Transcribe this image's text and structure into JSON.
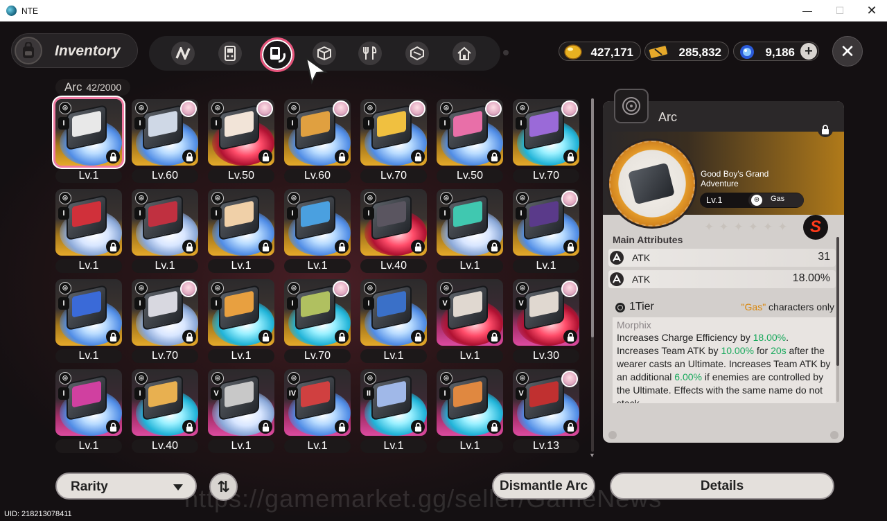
{
  "window": {
    "title": "NTE",
    "min": "—",
    "max": "☐",
    "close": "✕"
  },
  "header": {
    "title": "Inventory",
    "close_glyph": "✕"
  },
  "categories": [
    {
      "icon": "n-logo-icon"
    },
    {
      "icon": "handheld-console-icon"
    },
    {
      "icon": "arc-disc-icon",
      "active": true
    },
    {
      "icon": "cube-icon"
    },
    {
      "icon": "fork-knife-icon"
    },
    {
      "icon": "package-icon"
    },
    {
      "icon": "house-icon"
    }
  ],
  "currencies": [
    {
      "icon": "gold-egg-icon",
      "value": "427,171"
    },
    {
      "icon": "ticket-icon",
      "value": "285,832"
    },
    {
      "icon": "blue-orb-icon",
      "value": "9,186"
    }
  ],
  "currency_plus": "+",
  "arc": {
    "label": "Arc",
    "count": "42/2000"
  },
  "cards": [
    {
      "level": "Lv.1",
      "tier": "I",
      "rarity": "gold",
      "swirl": "blue",
      "avatar": false,
      "selected": true,
      "art": "#e8e8e8"
    },
    {
      "level": "Lv.60",
      "tier": "I",
      "rarity": "gold",
      "swirl": "blue",
      "avatar": true,
      "art": "#cfd8e6"
    },
    {
      "level": "Lv.50",
      "tier": "I",
      "rarity": "gold",
      "swirl": "red",
      "avatar": true,
      "art": "#f2e4d8"
    },
    {
      "level": "Lv.60",
      "tier": "I",
      "rarity": "gold",
      "swirl": "blue",
      "avatar": true,
      "art": "#e0a040"
    },
    {
      "level": "Lv.70",
      "tier": "I",
      "rarity": "gold",
      "swirl": "blue",
      "avatar": true,
      "art": "#f0c040"
    },
    {
      "level": "Lv.50",
      "tier": "I",
      "rarity": "gold",
      "swirl": "blue",
      "avatar": true,
      "art": "#e86fa8"
    },
    {
      "level": "Lv.70",
      "tier": "I",
      "rarity": "gold",
      "swirl": "cyan",
      "avatar": true,
      "art": "#9a6ad8"
    },
    {
      "level": "Lv.1",
      "tier": "I",
      "rarity": "gold",
      "swirl": "white",
      "avatar": false,
      "art": "#d0303a"
    },
    {
      "level": "Lv.1",
      "tier": "I",
      "rarity": "gold",
      "swirl": "white",
      "avatar": false,
      "art": "#c03040"
    },
    {
      "level": "Lv.1",
      "tier": "I",
      "rarity": "gold",
      "swirl": "blue",
      "avatar": false,
      "art": "#f0d0a8"
    },
    {
      "level": "Lv.1",
      "tier": "I",
      "rarity": "gold",
      "swirl": "blue",
      "avatar": false,
      "art": "#4aa0e0"
    },
    {
      "level": "Lv.40",
      "tier": "I",
      "rarity": "gold",
      "swirl": "red",
      "avatar": false,
      "art": "#5a5560"
    },
    {
      "level": "Lv.1",
      "tier": "I",
      "rarity": "gold",
      "swirl": "white",
      "avatar": false,
      "art": "#40c8b0"
    },
    {
      "level": "Lv.1",
      "tier": "I",
      "rarity": "gold",
      "swirl": "blue",
      "avatar": true,
      "art": "#5a3a8a"
    },
    {
      "level": "Lv.1",
      "tier": "I",
      "rarity": "gold",
      "swirl": "blue",
      "avatar": false,
      "art": "#3a6ad8"
    },
    {
      "level": "Lv.70",
      "tier": "I",
      "rarity": "gold",
      "swirl": "white",
      "avatar": true,
      "art": "#d8d8e0"
    },
    {
      "level": "Lv.1",
      "tier": "I",
      "rarity": "gold",
      "swirl": "cyan",
      "avatar": false,
      "art": "#e8a040"
    },
    {
      "level": "Lv.70",
      "tier": "I",
      "rarity": "gold",
      "swirl": "cyan",
      "avatar": true,
      "art": "#b0c060"
    },
    {
      "level": "Lv.1",
      "tier": "I",
      "rarity": "gold",
      "swirl": "blue",
      "avatar": false,
      "art": "#3a70c8"
    },
    {
      "level": "Lv.1",
      "tier": "V",
      "rarity": "pink",
      "swirl": "red",
      "avatar": false,
      "art": "#e0d8d0"
    },
    {
      "level": "Lv.30",
      "tier": "V",
      "rarity": "pink",
      "swirl": "red",
      "avatar": true,
      "art": "#e0d8d0"
    },
    {
      "level": "Lv.1",
      "tier": "I",
      "rarity": "pink",
      "swirl": "blue",
      "avatar": false,
      "art": "#d040a0"
    },
    {
      "level": "Lv.40",
      "tier": "I",
      "rarity": "pink",
      "swirl": "cyan",
      "avatar": false,
      "art": "#e8b050"
    },
    {
      "level": "Lv.1",
      "tier": "V",
      "rarity": "pink",
      "swirl": "white",
      "avatar": false,
      "art": "#c8c8c8"
    },
    {
      "level": "Lv.1",
      "tier": "IV",
      "rarity": "pink",
      "swirl": "blue",
      "avatar": false,
      "art": "#d04040"
    },
    {
      "level": "Lv.1",
      "tier": "II",
      "rarity": "pink",
      "swirl": "cyan",
      "avatar": false,
      "art": "#a0b8e8"
    },
    {
      "level": "Lv.1",
      "tier": "I",
      "rarity": "pink",
      "swirl": "cyan",
      "avatar": false,
      "art": "#e08840"
    },
    {
      "level": "Lv.13",
      "tier": "V",
      "rarity": "pink",
      "swirl": "blue",
      "avatar": true,
      "art": "#c03030"
    }
  ],
  "detail": {
    "header": "Arc",
    "name": "Good Boy's Grand Adventure",
    "level": "Lv.1",
    "element": "Gas",
    "stars": "✦✦✦✦✦✦",
    "grade": "S",
    "attributes_title": "Main Attributes",
    "attributes": [
      {
        "name": "ATK",
        "value": "31"
      },
      {
        "name": "ATK",
        "value": "18.00%"
      }
    ],
    "tier_label": "1Tier",
    "requirement_highlight": "\"Gas\"",
    "requirement_rest": " characters only",
    "effect_title": "Morphix",
    "effect_segments": [
      {
        "t": "Increases Charge Efficiency by "
      },
      {
        "t": "18.00%",
        "hl": true
      },
      {
        "t": ". Increases Team ATK by "
      },
      {
        "t": "10.00%",
        "hl": true
      },
      {
        "t": " for "
      },
      {
        "t": "20s",
        "hl": true
      },
      {
        "t": " after the wearer casts an Ultimate. Increases Team ATK by an additional "
      },
      {
        "t": "6.00%",
        "hl": true
      },
      {
        "t": " if enemies are controlled by the Ultimate. Effects with the same name do not stack."
      }
    ]
  },
  "footer": {
    "rarity_label": "Rarity",
    "sort_glyph": "⇅",
    "dismantle_label": "Dismantle Arc",
    "details_label": "Details",
    "uid": "UID: 218213078411",
    "watermark": "https://gamemarket.gg/seller/GameNews"
  },
  "colors": {
    "accent_pink": "#e8547c",
    "gold_rarity": "#e6a92a",
    "pink_rarity": "#dd4aa0",
    "highlight_green": "#17a85b",
    "gas_orange": "#d9860a"
  }
}
